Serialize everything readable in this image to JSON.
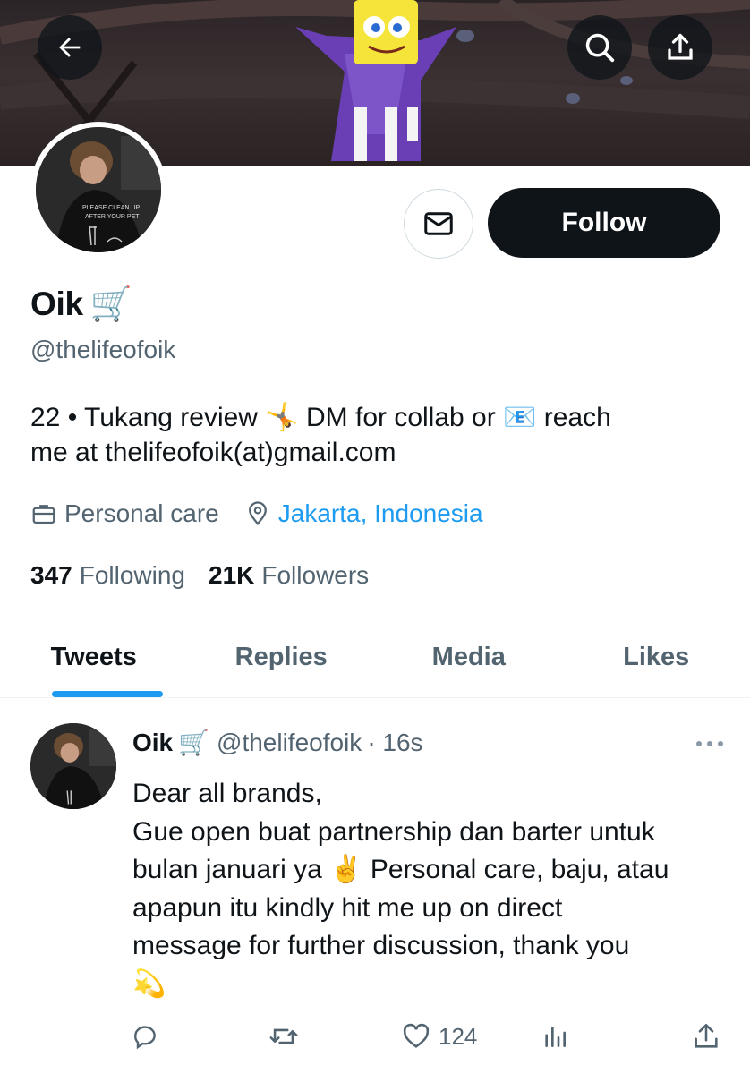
{
  "header": {
    "back_icon": "arrow-left-icon",
    "search_icon": "search-icon",
    "share_icon": "share-upload-icon"
  },
  "profile": {
    "name": "Oik",
    "name_emoji": "🛒",
    "handle": "@thelifeofoik",
    "bio_lines": [
      "22 • Tukang review 🤸 DM for collab or 📧 reach",
      "me at thelifeofoik(at)gmail.com"
    ],
    "category": "Personal care",
    "location": "Jakarta, Indonesia",
    "following_count": "347",
    "following_label": "Following",
    "followers_count": "21K",
    "followers_label": "Followers",
    "follow_label": "Follow",
    "message_icon": "mail-icon"
  },
  "tabs": [
    {
      "label": "Tweets",
      "active": true
    },
    {
      "label": "Replies",
      "active": false
    },
    {
      "label": "Media",
      "active": false
    },
    {
      "label": "Likes",
      "active": false
    }
  ],
  "tweet": {
    "name": "Oik",
    "name_emoji": "🛒",
    "handle": "@thelifeofoik",
    "time": "· 16s",
    "body_lines": [
      "Dear all brands,",
      "Gue open buat partnership dan barter untuk",
      "bulan januari ya ✌️ Personal care, baju, atau",
      "apapun itu kindly hit me up on direct",
      "message for further discussion, thank you",
      "💫"
    ],
    "likes": "124"
  },
  "colors": {
    "accent": "#1d9bf0",
    "text": "#0f1419",
    "secondary": "#536471",
    "border": "#eff3f4"
  }
}
